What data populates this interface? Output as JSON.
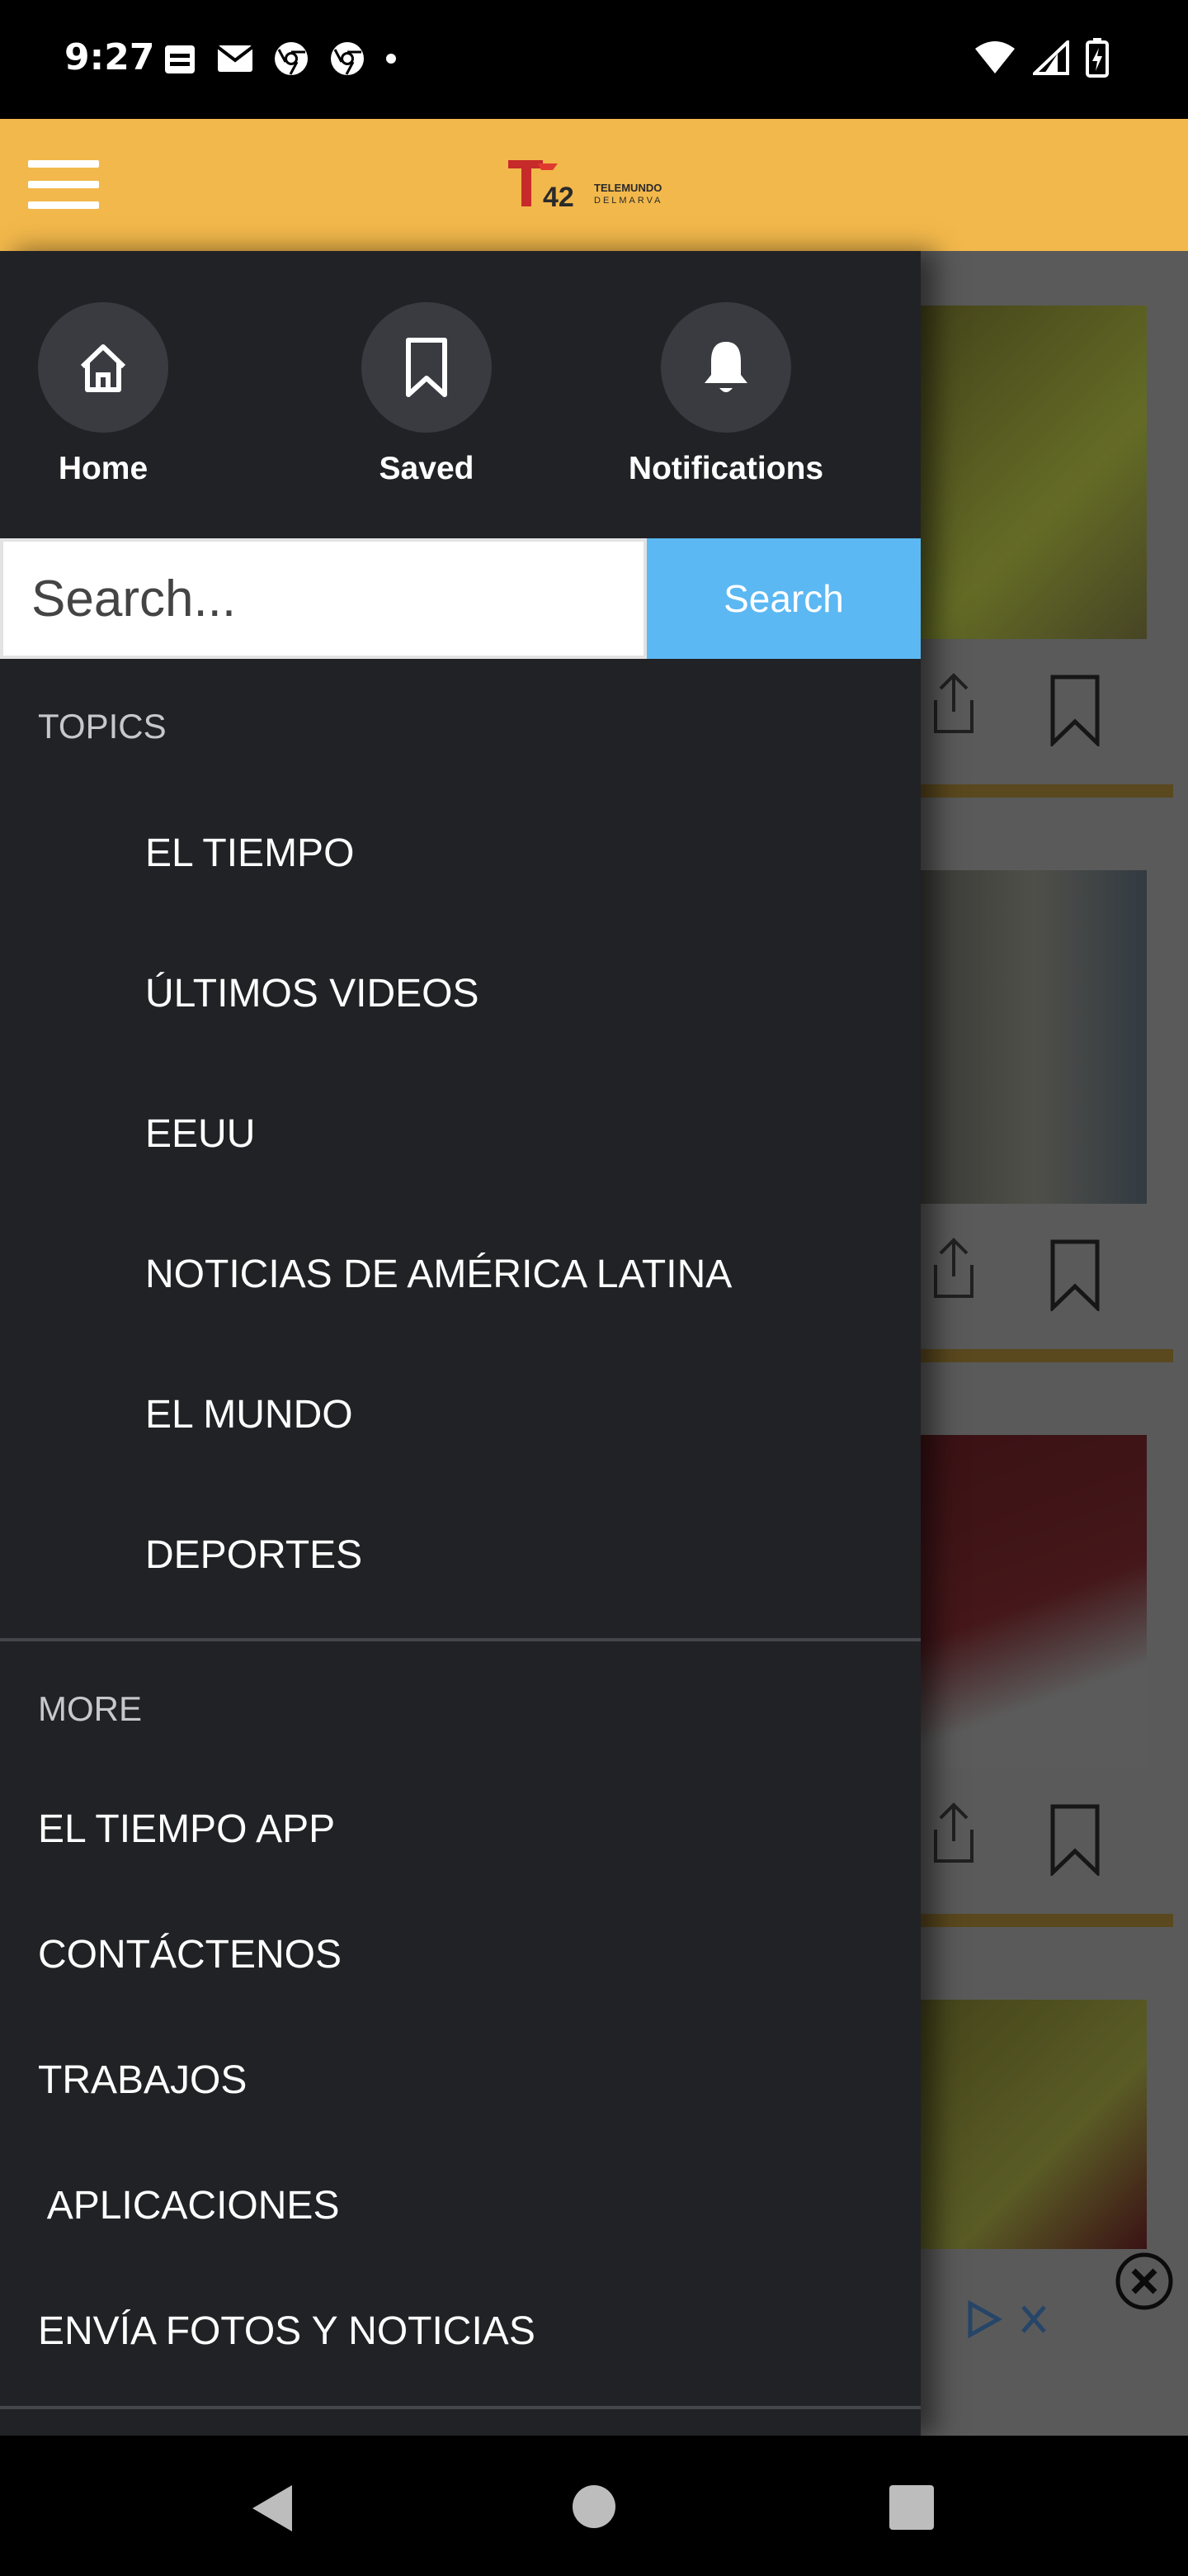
{
  "status_bar": {
    "time": "9:27",
    "left_icons": [
      "calendar-icon",
      "mail-icon",
      "chrome-icon",
      "chrome-icon",
      "dot-icon"
    ],
    "right_icons": [
      "wifi-icon",
      "signal-icon",
      "battery-charging-icon"
    ]
  },
  "header": {
    "menu_icon": "hamburger-icon",
    "logo_number": "42",
    "logo_line1": "TELEMUNDO",
    "logo_line2": "DELMARVA",
    "brand_color": "#f2b84b"
  },
  "drawer": {
    "quick_links": [
      {
        "label": "Home",
        "icon": "home-icon"
      },
      {
        "label": "Saved",
        "icon": "bookmark-icon"
      },
      {
        "label": "Notifications",
        "icon": "bell-icon"
      }
    ],
    "search": {
      "placeholder": "Search...",
      "button_label": "Search",
      "button_color": "#5cb8f2"
    },
    "topics": {
      "heading": "TOPICS",
      "items": [
        "EL TIEMPO",
        "ÚLTIMOS VIDEOS",
        "EEUU",
        "NOTICIAS DE AMÉRICA LATINA",
        "EL MUNDO",
        "DEPORTES"
      ]
    },
    "more": {
      "heading": "MORE",
      "items": [
        "EL TIEMPO APP",
        "CONTÁCTENOS",
        "TRABAJOS",
        " APLICACIONES",
        "ENVÍA FOTOS Y NOTICIAS"
      ]
    }
  },
  "background": {
    "icons": [
      "share-icon",
      "bookmark-outline-icon",
      "close-circle-icon",
      "ad-choices-icon"
    ]
  },
  "nav_bar": {
    "icons": [
      "back-icon",
      "home-circle-icon",
      "recents-square-icon"
    ]
  }
}
